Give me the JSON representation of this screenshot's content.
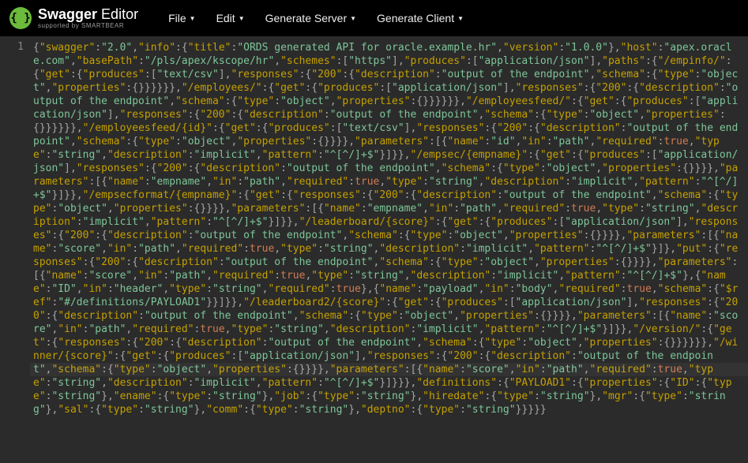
{
  "brand": {
    "logo_glyph": "{ }",
    "name_html": "swagger_editor_label",
    "name_prefix": "Swagger",
    "name_suffix": "Editor",
    "sub": "supported by SMARTBEAR"
  },
  "menu": {
    "file": "File",
    "edit": "Edit",
    "gen_server": "Generate Server",
    "gen_client": "Generate Client",
    "caret": "▼"
  },
  "gutter": {
    "line1": "1"
  },
  "colors": {
    "accent": "#6cbb3c",
    "bool": "#d27b53"
  },
  "swagger_json": {
    "swagger": "2.0",
    "info": {
      "title": "ORDS generated API for oracle.example.hr",
      "version": "1.0.0"
    },
    "host": "apex.oracle.com",
    "basePath": "/pls/apex/kscope/hr",
    "schemes": [
      "https"
    ],
    "produces": [
      "application/json"
    ],
    "paths": {
      "/empinfo/": {
        "get": {
          "produces": [
            "text/csv"
          ],
          "responses": {
            "200": {
              "description": "output of the endpoint",
              "schema": {
                "type": "object",
                "properties": {}
              }
            }
          }
        }
      },
      "/employees/": {
        "get": {
          "produces": [
            "application/json"
          ],
          "responses": {
            "200": {
              "description": "output of the endpoint",
              "schema": {
                "type": "object",
                "properties": {}
              }
            }
          }
        }
      },
      "/employeesfeed/": {
        "get": {
          "produces": [
            "application/json"
          ],
          "responses": {
            "200": {
              "description": "output of the endpoint",
              "schema": {
                "type": "object",
                "properties": {}
              }
            }
          }
        }
      },
      "/employeesfeed/{id}": {
        "get": {
          "produces": [
            "text/csv"
          ],
          "responses": {
            "200": {
              "description": "output of the endpoint",
              "schema": {
                "type": "object",
                "properties": {}
              }
            }
          },
          "parameters": [
            {
              "name": "id",
              "in": "path",
              "required": true,
              "type": "string",
              "description": "implicit",
              "pattern": "^[^/]+$"
            }
          ]
        }
      },
      "/empsec/{empname}": {
        "get": {
          "produces": [
            "application/json"
          ],
          "responses": {
            "200": {
              "description": "output of the endpoint",
              "schema": {
                "type": "object",
                "properties": {}
              }
            }
          },
          "parameters": [
            {
              "name": "empname",
              "in": "path",
              "required": true,
              "type": "string",
              "description": "implicit",
              "pattern": "^[^/]+$"
            }
          ]
        }
      },
      "/empsecformat/{empname}": {
        "get": {
          "responses": {
            "200": {
              "description": "output of the endpoint",
              "schema": {
                "type": "object",
                "properties": {}
              }
            }
          },
          "parameters": [
            {
              "name": "empname",
              "in": "path",
              "required": true,
              "type": "string",
              "description": "implicit",
              "pattern": "^[^/]+$"
            }
          ]
        }
      },
      "/leaderboard/{score}": {
        "get": {
          "produces": [
            "application/json"
          ],
          "responses": {
            "200": {
              "description": "output of the endpoint",
              "schema": {
                "type": "object",
                "properties": {}
              }
            }
          },
          "parameters": [
            {
              "name": "score",
              "in": "path",
              "required": true,
              "type": "string",
              "description": "implicit",
              "pattern": "^[^/]+$"
            }
          ]
        },
        "put": {
          "responses": {
            "200": {
              "description": "output of the endpoint",
              "schema": {
                "type": "object",
                "properties": {}
              }
            }
          },
          "parameters": [
            {
              "name": "score",
              "in": "path",
              "required": true,
              "type": "string",
              "description": "implicit",
              "pattern": "^[^/]+$"
            },
            {
              "name": "ID",
              "in": "header",
              "type": "string",
              "required": true
            },
            {
              "name": "payload",
              "in": "body",
              "required": true,
              "schema": {
                "$ref": "#/definitions/PAYLOAD1"
              }
            }
          ]
        }
      },
      "/leaderboard2/{score}": {
        "get": {
          "produces": [
            "application/json"
          ],
          "responses": {
            "200": {
              "description": "output of the endpoint",
              "schema": {
                "type": "object",
                "properties": {}
              }
            }
          },
          "parameters": [
            {
              "name": "score",
              "in": "path",
              "required": true,
              "type": "string",
              "description": "implicit",
              "pattern": "^[^/]+$"
            }
          ]
        }
      },
      "/version/": {
        "get": {
          "responses": {
            "200": {
              "description": "output of the endpoint",
              "schema": {
                "type": "object",
                "properties": {}
              }
            }
          }
        }
      },
      "/winner/{score}": {
        "get": {
          "produces": [
            "application/json"
          ],
          "responses": {
            "200": {
              "description": "output of the endpoint",
              "schema": {
                "type": "object",
                "properties": {}
              }
            }
          },
          "parameters": [
            {
              "name": "score",
              "in": "path",
              "required": true,
              "type": "string",
              "description": "implicit",
              "pattern": "^[^/]+$"
            }
          ]
        }
      }
    },
    "definitions": {
      "PAYLOAD1": {
        "properties": {
          "ID": {
            "type": "string"
          },
          "ename": {
            "type": "string"
          },
          "job": {
            "type": "string"
          },
          "hiredate": {
            "type": "string"
          },
          "mgr": {
            "type": "string"
          },
          "sal": {
            "type": "string"
          },
          "comm": {
            "type": "string"
          },
          "deptno": {
            "type": "string"
          }
        }
      }
    }
  },
  "cursor_marker": "^[^/|]+$"
}
